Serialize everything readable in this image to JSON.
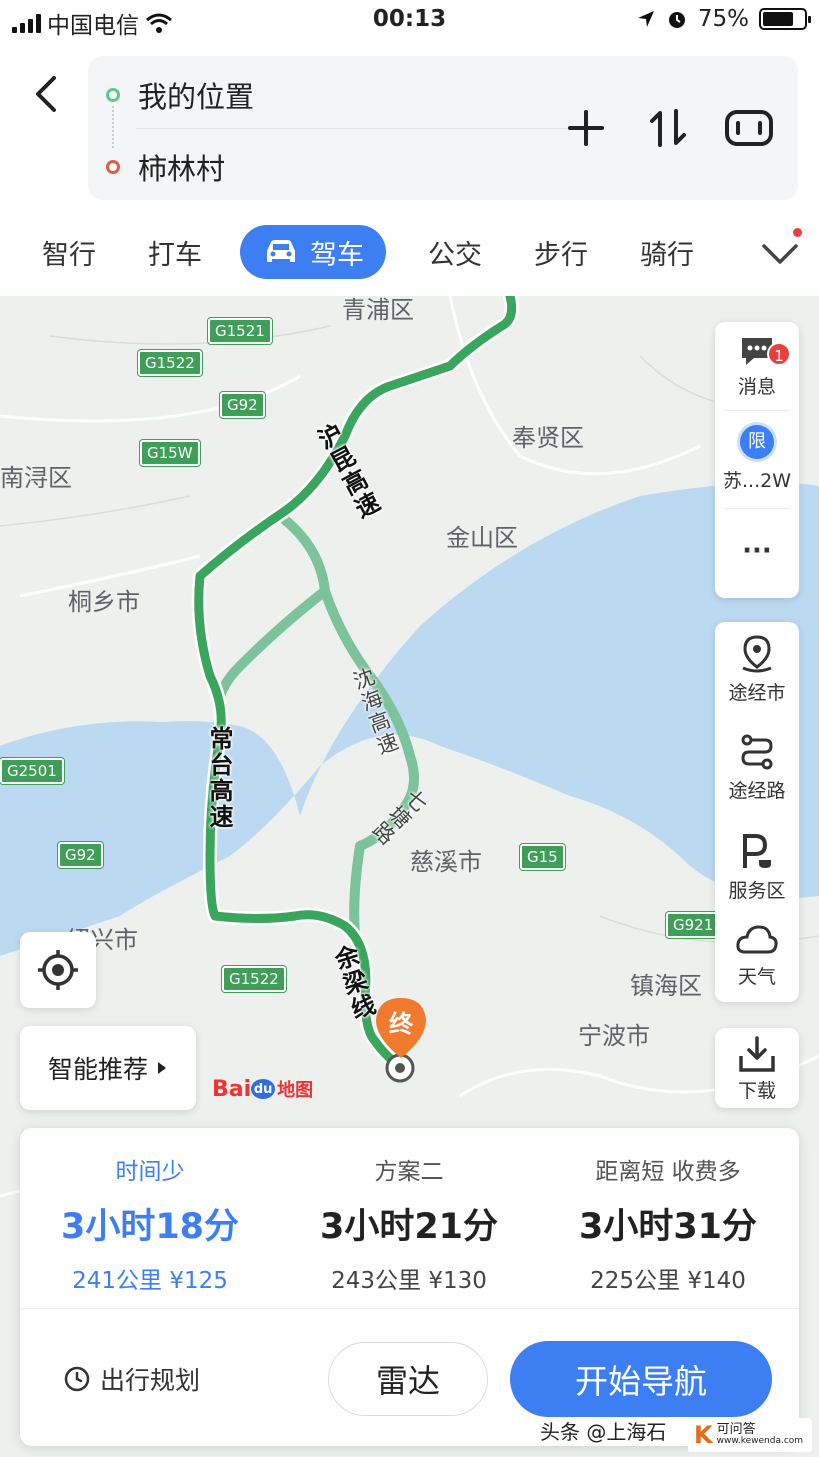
{
  "status_bar": {
    "carrier": "中国电信",
    "time": "00:13",
    "battery": "75%",
    "battery_level": 0.75
  },
  "route": {
    "from": "我的位置",
    "to": "柿林村"
  },
  "tabs": [
    {
      "label": "智行"
    },
    {
      "label": "打车"
    },
    {
      "label": "驾车",
      "active": true
    },
    {
      "label": "公交"
    },
    {
      "label": "步行"
    },
    {
      "label": "骑行"
    }
  ],
  "map": {
    "places": [
      "青浦区",
      "奉贤区",
      "南浔区",
      "金山区",
      "桐乡市",
      "慈溪市",
      "绍兴市",
      "镇海区",
      "宁波市"
    ],
    "shields": [
      "G1521",
      "G1522",
      "G92",
      "G15W",
      "G2501",
      "G92",
      "G15",
      "G9211",
      "G1522",
      "G1522"
    ],
    "roads": [
      "沪昆高速",
      "常台高速",
      "沈海高速",
      "七塘路",
      "余梁线"
    ],
    "end_marker": "终"
  },
  "side_panel": {
    "message": "消息",
    "message_badge": "1",
    "limit": "苏...2W",
    "limit_icon": "限",
    "more": "···",
    "via_city": "途经市",
    "via_road": "途经路",
    "service_area": "服务区",
    "weather": "天气",
    "download": "下载"
  },
  "smart_recommend": "智能推荐",
  "logo": {
    "bai": "Bai",
    "du": "du",
    "ditu": "地图"
  },
  "plans": [
    {
      "label": "时间少",
      "duration": "3小时18分",
      "meta": "241公里 ¥125",
      "selected": true
    },
    {
      "label": "方案二",
      "duration": "3小时21分",
      "meta": "243公里 ¥130"
    },
    {
      "label": "距离短 收费多",
      "duration": "3小时31分",
      "meta": "225公里 ¥140"
    }
  ],
  "actions": {
    "trip_plan": "出行规划",
    "radar": "雷达",
    "start_navigation": "开始导航"
  },
  "watermark": {
    "text": "头条 @上海石",
    "site": "可问答",
    "site_url": "www.kewenda.com"
  },
  "colors": {
    "accent": "#3d7ff2",
    "route_main": "#3aa55c",
    "route_alt": "#7cc29a",
    "water": "#bcd9f2"
  }
}
